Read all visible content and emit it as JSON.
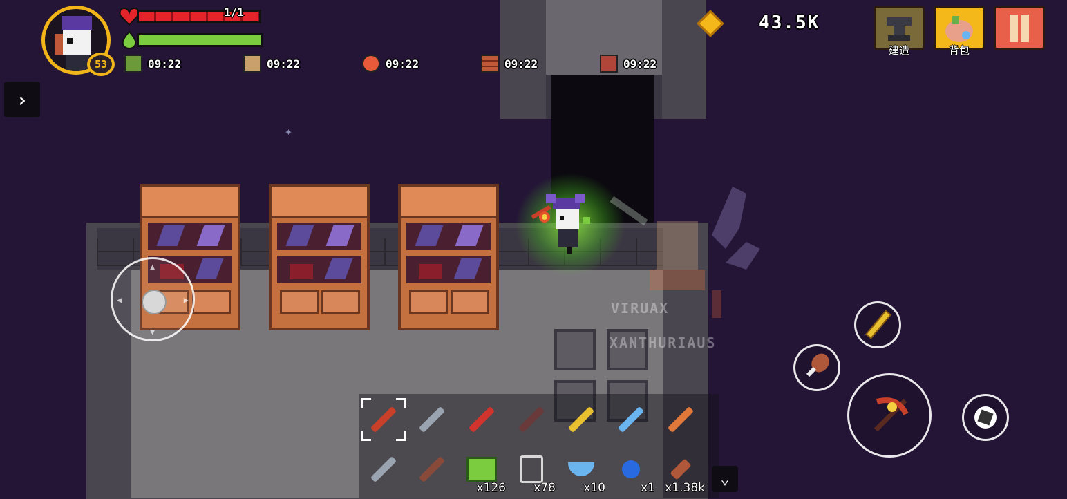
{
  "player": {
    "level": "53",
    "hp_text": "1/1",
    "hp_fraction": 1.0,
    "mana_fraction": 1.0
  },
  "buffs": [
    {
      "icon": "clover-buff-icon",
      "time": "09:22",
      "color": "#6b9a3a"
    },
    {
      "icon": "scroll-buff-icon",
      "time": "09:22",
      "color": "#c9a06b"
    },
    {
      "icon": "magnet-buff-icon",
      "time": "09:22",
      "color": "#e85a3a"
    },
    {
      "icon": "brick-buff-icon",
      "time": "09:22",
      "color": "#c0583a"
    },
    {
      "icon": "chest-buff-icon",
      "time": "09:22",
      "color": "#b0463a"
    }
  ],
  "currency": {
    "icon": "gem-icon",
    "amount": "43.5K"
  },
  "top_buttons": [
    {
      "icon": "anvil-icon",
      "label": "建造"
    },
    {
      "icon": "backpack-icon",
      "label": "背包"
    },
    {
      "icon": "scroll-map-icon",
      "label": ""
    }
  ],
  "world": {
    "npc_names": [
      "VIRUAX",
      "XANTHURIAUS"
    ]
  },
  "hotbar": {
    "row1": [
      {
        "icon": "pickaxe-icon",
        "color": "#c8402a",
        "qty": "",
        "selected": true
      },
      {
        "icon": "shovel-icon",
        "color": "#9aa4b0",
        "qty": ""
      },
      {
        "icon": "red-sword-icon",
        "color": "#d0342c",
        "qty": ""
      },
      {
        "icon": "crossbow-icon",
        "color": "#6a3a3a",
        "qty": ""
      },
      {
        "icon": "golden-sword-icon",
        "color": "#e8c030",
        "qty": ""
      },
      {
        "icon": "ice-spear-icon",
        "color": "#6ab4f0",
        "qty": ""
      },
      {
        "icon": "fire-torch-icon",
        "color": "#e0783a",
        "qty": ""
      }
    ],
    "row2": [
      {
        "icon": "hammer-icon",
        "color": "#9aa4b0",
        "qty": ""
      },
      {
        "icon": "fishing-rod-icon",
        "color": "#8a4a3a",
        "qty": ""
      },
      {
        "icon": "green-block-icon",
        "color": "#7ccc3f",
        "qty": "x126"
      },
      {
        "icon": "glass-jar-icon",
        "color": "#d8d8d8",
        "qty": "x78"
      },
      {
        "icon": "food-bowl-icon",
        "color": "#6ab4f0",
        "qty": "x10"
      },
      {
        "icon": "blue-bomb-icon",
        "color": "#2a6ae0",
        "qty": "x1"
      },
      {
        "icon": "meat-leg-icon",
        "color": "#b0583a",
        "qty": "x1.38k"
      }
    ]
  },
  "actions": {
    "attack": "pickaxe-attack-icon",
    "quick_weapon": "golden-sword-icon",
    "quick_food": "meat-leg-icon",
    "dodge": "dodge-roll-icon"
  }
}
